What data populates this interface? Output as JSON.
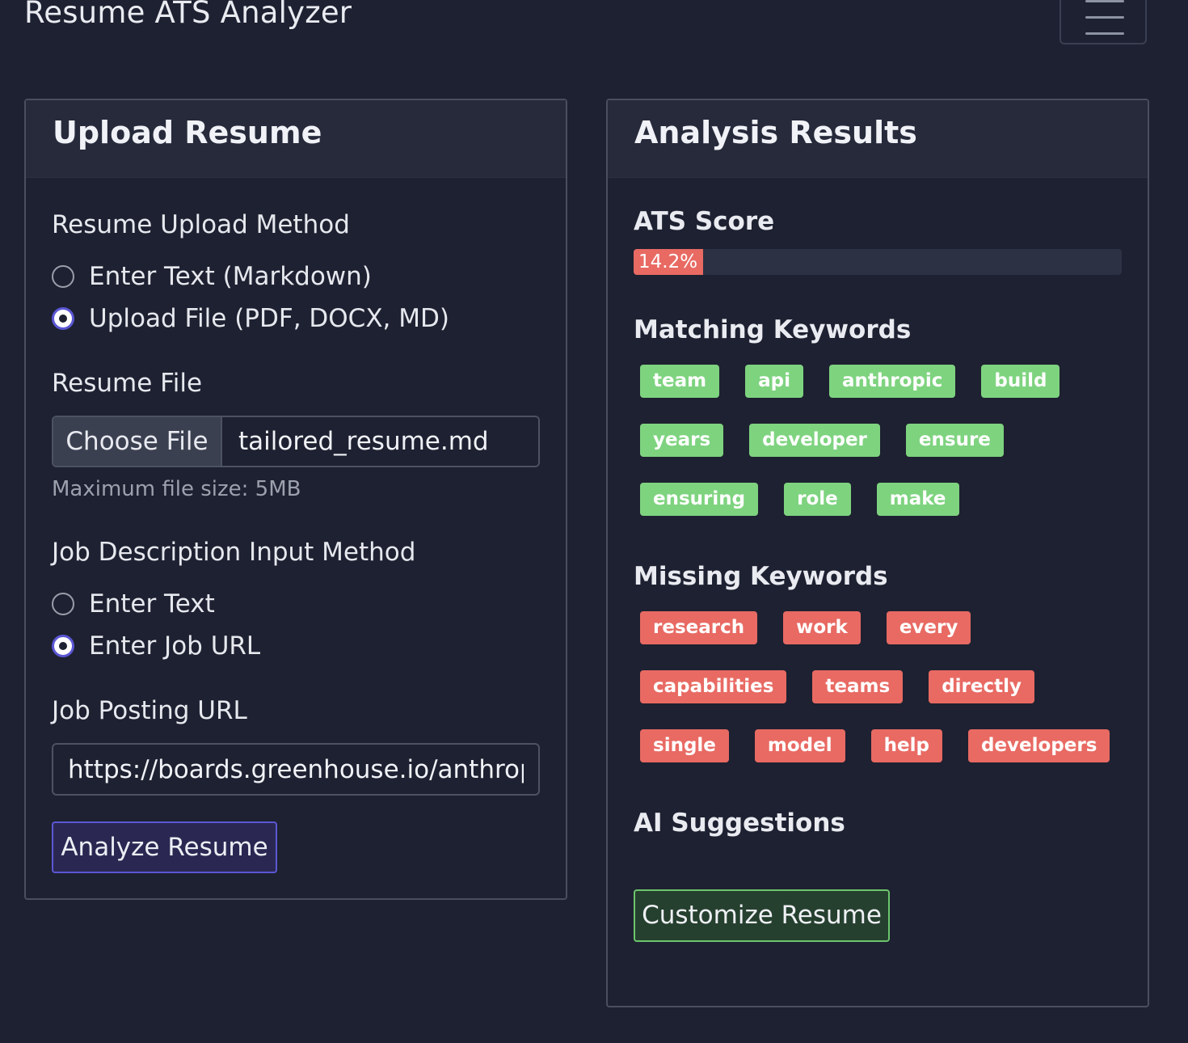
{
  "app": {
    "title": "Resume ATS Analyzer",
    "menu_icon": "hamburger-menu-icon"
  },
  "upload": {
    "title": "Upload Resume",
    "resume_method_label": "Resume Upload Method",
    "resume_methods": [
      {
        "label": "Enter Text (Markdown)",
        "checked": false
      },
      {
        "label": "Upload File (PDF, DOCX, MD)",
        "checked": true
      }
    ],
    "resume_file_label": "Resume File",
    "choose_file_label": "Choose File",
    "file_name": "tailored_resume.md",
    "file_help": "Maximum file size: 5MB",
    "job_method_label": "Job Description Input Method",
    "job_methods": [
      {
        "label": "Enter Text",
        "checked": false
      },
      {
        "label": "Enter Job URL",
        "checked": true
      }
    ],
    "job_url_label": "Job Posting URL",
    "job_url_value": "https://boards.greenhouse.io/anthropic",
    "analyze_label": "Analyze Resume"
  },
  "results": {
    "title": "Analysis Results",
    "ats_score_label": "ATS Score",
    "ats_score_text": "14.2%",
    "ats_score_value": 14.2,
    "matching_label": "Matching Keywords",
    "matching_keywords": [
      "team",
      "api",
      "anthropic",
      "build",
      "years",
      "developer",
      "ensure",
      "ensuring",
      "role",
      "make"
    ],
    "missing_label": "Missing Keywords",
    "missing_keywords": [
      "research",
      "work",
      "every",
      "capabilities",
      "teams",
      "directly",
      "single",
      "model",
      "help",
      "developers"
    ],
    "suggestions_label": "AI Suggestions",
    "customize_label": "Customize Resume"
  },
  "colors": {
    "background": "#1e2131",
    "accent_primary": "#5b57d4",
    "match_tag": "#7ed37f",
    "missing_tag": "#e86a63",
    "success_border": "#6bc56d"
  }
}
